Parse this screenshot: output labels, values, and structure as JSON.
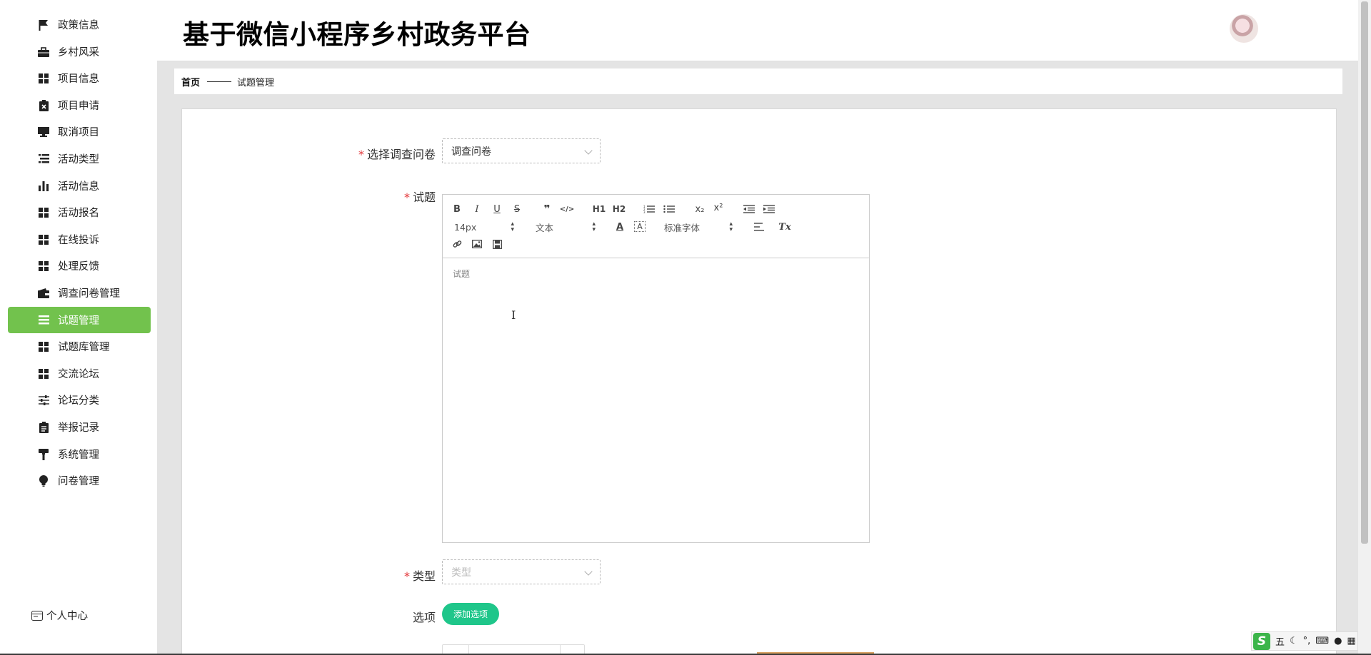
{
  "app": {
    "title": "基于微信小程序乡村政务平台"
  },
  "sidebar": {
    "items": [
      {
        "label": "政策信息",
        "icon": "flag-icon"
      },
      {
        "label": "乡村风采",
        "icon": "briefcase-icon"
      },
      {
        "label": "项目信息",
        "icon": "grid-icon"
      },
      {
        "label": "项目申请",
        "icon": "clipboard-x-icon"
      },
      {
        "label": "取消项目",
        "icon": "monitor-icon"
      },
      {
        "label": "活动类型",
        "icon": "list-icon"
      },
      {
        "label": "活动信息",
        "icon": "bar-chart-icon"
      },
      {
        "label": "活动报名",
        "icon": "grid-icon"
      },
      {
        "label": "在线投诉",
        "icon": "grid-icon"
      },
      {
        "label": "处理反馈",
        "icon": "grid-icon"
      },
      {
        "label": "调查问卷管理",
        "icon": "wallet-icon"
      },
      {
        "label": "试题管理",
        "icon": "menu-icon"
      },
      {
        "label": "试题库管理",
        "icon": "grid-icon"
      },
      {
        "label": "交流论坛",
        "icon": "grid-icon"
      },
      {
        "label": "论坛分类",
        "icon": "sliders-icon"
      },
      {
        "label": "举报记录",
        "icon": "clipboard-icon"
      },
      {
        "label": "系统管理",
        "icon": "paint-roller-icon"
      },
      {
        "label": "问卷管理",
        "icon": "lightbulb-icon"
      }
    ],
    "active_index": 11,
    "personal_center": "个人中心"
  },
  "breadcrumb": {
    "home": "首页",
    "current": "试题管理"
  },
  "form": {
    "survey_label": "选择调查问卷",
    "survey_value": "调查问卷",
    "question_label": "试题",
    "question_placeholder": "试题",
    "type_label": "类型",
    "type_placeholder": "类型",
    "options_label": "选项",
    "add_option_button": "添加选项",
    "required_mark": "*"
  },
  "editor_toolbar": {
    "bold": "B",
    "italic": "I",
    "underline": "U",
    "strike": "S",
    "quote": "❞",
    "code": "</>",
    "h1": "H1",
    "h2": "H2",
    "ordered_list": "ordered-list-icon",
    "bullet_list": "bullet-list-icon",
    "subscript": "x₂",
    "superscript": "x²",
    "outdent": "outdent-icon",
    "indent": "indent-icon",
    "size": "14px",
    "block": "文本",
    "font_color": "A",
    "background": "A",
    "font": "标准字体",
    "align": "align-left-icon",
    "clean": "Tx",
    "link": "link-icon",
    "image": "image-icon",
    "video": "film-icon"
  },
  "tray": {
    "ime_mode": "五"
  },
  "colors": {
    "sidebar_active": "#72c24d",
    "add_button": "#1fc68a",
    "required": "#e4393c"
  }
}
